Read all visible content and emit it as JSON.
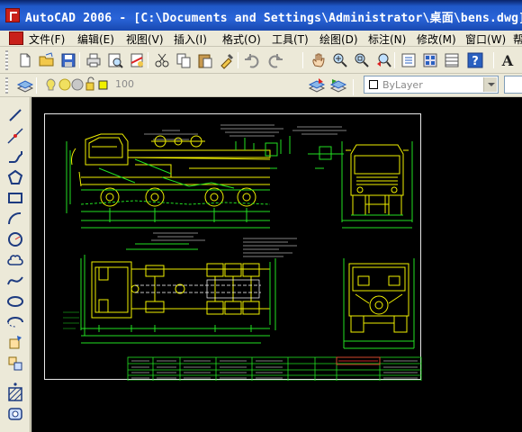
{
  "window": {
    "title": "AutoCAD 2006 - [C:\\Documents and Settings\\Administrator\\桌面\\bens.dwg]"
  },
  "menu": {
    "items": [
      {
        "label": "文件(F)"
      },
      {
        "label": "编辑(E)"
      },
      {
        "label": "视图(V)"
      },
      {
        "label": "插入(I)"
      },
      {
        "label": "格式(O)"
      },
      {
        "label": "工具(T)"
      },
      {
        "label": "绘图(D)"
      },
      {
        "label": "标注(N)"
      },
      {
        "label": "修改(M)"
      },
      {
        "label": "窗口(W)"
      },
      {
        "label": "帮"
      }
    ]
  },
  "layers_toolbar": {
    "current_layer": "100",
    "color_control": "ByLayer"
  },
  "icons": {
    "standard": [
      "new-file-icon",
      "open-icon",
      "save-icon",
      "plot-icon",
      "plot-preview-icon",
      "publish-icon",
      "cut-icon",
      "copy-icon",
      "paste-icon",
      "match-properties-icon",
      "undo-icon",
      "redo-icon",
      "pan-icon",
      "zoom-realtime-icon",
      "zoom-window-icon",
      "zoom-previous-icon",
      "properties-icon",
      "design-center-icon",
      "tool-palettes-icon",
      "help-icon",
      "text-icon"
    ],
    "draw": [
      "line-icon",
      "construction-line-icon",
      "polyline-icon",
      "polygon-icon",
      "rectangle-icon",
      "arc-icon",
      "circle-icon",
      "revision-cloud-icon",
      "spline-icon",
      "ellipse-icon",
      "ellipse-arc-icon",
      "insert-block-icon",
      "make-block-icon",
      "point-icon",
      "hatch-icon",
      "region-icon"
    ]
  },
  "colors": {
    "title_bar": "#1f58c8",
    "model_space": "#000000",
    "drawing_yellow": "#f0f000",
    "drawing_green": "#22e022",
    "drawing_red": "#ff3030"
  }
}
